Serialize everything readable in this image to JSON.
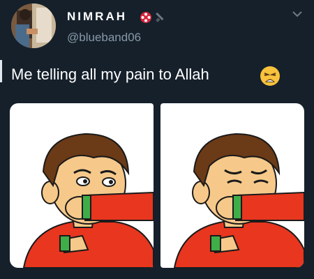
{
  "tweet": {
    "author": {
      "display_name": "NIMRAH",
      "handle": "@blueband06",
      "avatar_icon": "avatar-photo",
      "badge_icon": "red-flower-badge",
      "extra_icon": "paintbrush-icon"
    },
    "text": "Me telling all my pain to Allah",
    "emoji": "weary-face",
    "menu_icon": "chevron-down-icon",
    "media": [
      {
        "alt_name": "cartoon-boy-covering-mouth"
      },
      {
        "alt_name": "cartoon-boy-crying-into-arm"
      }
    ]
  },
  "colors": {
    "background": "#15202b",
    "text_primary": "#ffffff",
    "text_secondary": "#8899a6",
    "shirt_red": "#e8361f",
    "cuff_green": "#3fae49",
    "hair_brown": "#6b3a17",
    "skin": "#f6c98a"
  }
}
